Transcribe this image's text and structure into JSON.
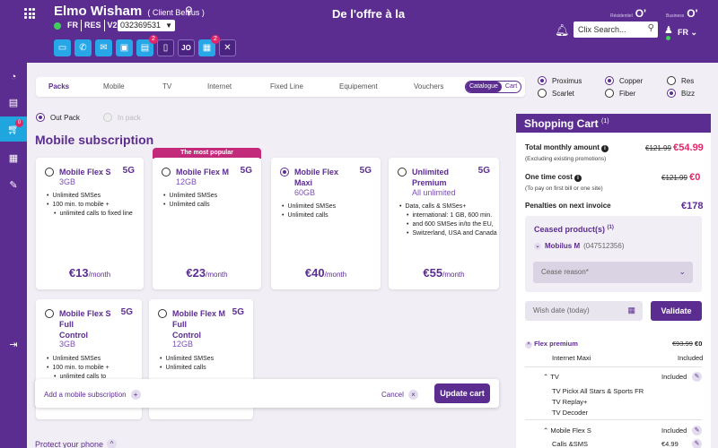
{
  "header": {
    "client_name": "Elmo Wisham",
    "client_tag": "( Client Belfius )",
    "segments": [
      "FR",
      "RES",
      "V2"
    ],
    "number": "032369531",
    "title": "De l'offre à la",
    "brands": [
      {
        "label": "Résidentiel",
        "mark": "O'"
      },
      {
        "label": "Business",
        "mark": "O'"
      }
    ],
    "search_placeholder": "Clix Search...",
    "language": "FR",
    "toolbar_jo": "JO",
    "tool_badges": [
      "2",
      "2"
    ]
  },
  "sidebar": {
    "cart_badge": "0"
  },
  "tabs": {
    "items": [
      "Packs",
      "Mobile",
      "TV",
      "Internet",
      "Fixed Line",
      "Equipement",
      "Vouchers"
    ],
    "active": "Packs",
    "toggle": [
      "Catalogue",
      "Cart"
    ]
  },
  "filters": {
    "provider": [
      "Proximus",
      "Scarlet"
    ],
    "line": [
      "Copper",
      "Fiber"
    ],
    "segment": [
      "Res",
      "Bizz"
    ]
  },
  "pack_mode": {
    "out_pack": "Out Pack",
    "in_pack": "In pack"
  },
  "section_title": "Mobile subscription",
  "popular_label": "The most popular",
  "cards": [
    {
      "name": "Mobile Flex S",
      "network": "5G",
      "data": "3GB",
      "features": [
        "Unlimited SMSes",
        "100 min. to mobile +",
        "unlimited calls to fixed line"
      ],
      "price": "€13",
      "unit": "/month"
    },
    {
      "name": "Mobile Flex M",
      "network": "5G",
      "data": "12GB",
      "features": [
        "Unlimited SMSes",
        "Unlimited calls"
      ],
      "price": "€23",
      "unit": "/month"
    },
    {
      "name_lines": [
        "Mobile Flex",
        "Maxi"
      ],
      "network": "5G",
      "data": "60GB",
      "features": [
        "Unlimited SMSes",
        "Unlimited calls"
      ],
      "price": "€40",
      "unit": "/month"
    },
    {
      "name_lines": [
        "Unlimited",
        "Premium"
      ],
      "network": "5G",
      "data": "All unlimited",
      "features": [
        "Data, calls & SMSes+",
        "international: 1 GB, 600 min.",
        "and 600 SMSes in/to the EU,",
        "Switzerland, USA and Canada"
      ],
      "price": "€55",
      "unit": "/month"
    },
    {
      "name_lines": [
        "Mobile Flex  S",
        "Full",
        "Control"
      ],
      "network": "5G",
      "data": "3GB",
      "features": [
        "Unlimited SMSes",
        "100 min. to mobile +",
        "unlimited calls to"
      ]
    },
    {
      "name_lines": [
        "Mobile Flex M",
        "Full",
        "Control"
      ],
      "network": "5G",
      "data": "12GB",
      "features": [
        "Unlimited SMSes",
        "Unlimited calls"
      ]
    }
  ],
  "bottom_bar": {
    "add_link": "Add a mobile subscription",
    "cancel": "Cancel",
    "update": "Update cart"
  },
  "protect_link": "Protect your phone",
  "cart": {
    "title": "Shopping Cart",
    "title_count": "(1)",
    "monthly_label": "Total monthly amount",
    "monthly_note": "(Excluding existing promotions)",
    "monthly_old": "€121.99",
    "monthly_new": "€54.99",
    "onetime_label": "One time cost",
    "onetime_note": "(To pay on first bill or one site)",
    "onetime_old": "€121.99",
    "onetime_new": "€0",
    "penalties_label": "Penalties on next invoice",
    "penalties_value": "€178",
    "ceased_title": "Ceased product(s)",
    "ceased_count": "(1)",
    "ceased_name": "Mobilus M",
    "ceased_msisdn": "(047512356)",
    "reason_placeholder": "Cease reason*",
    "wish_placeholder": "Wish date (today)",
    "validate": "Validate",
    "flex_premium": "Flex premium",
    "flex_old": "€93.99",
    "flex_new": "€0",
    "internet_maxi": "Internet Maxi",
    "included": "Included",
    "tv": "TV",
    "tv_items": [
      "TV Pickx All Stars & Sports FR",
      "TV Replay+",
      "TV Decoder"
    ],
    "mobile_flex_s": "Mobile Flex S",
    "calls_sms": "Calls &SMS",
    "calls_price": "€4.99"
  }
}
